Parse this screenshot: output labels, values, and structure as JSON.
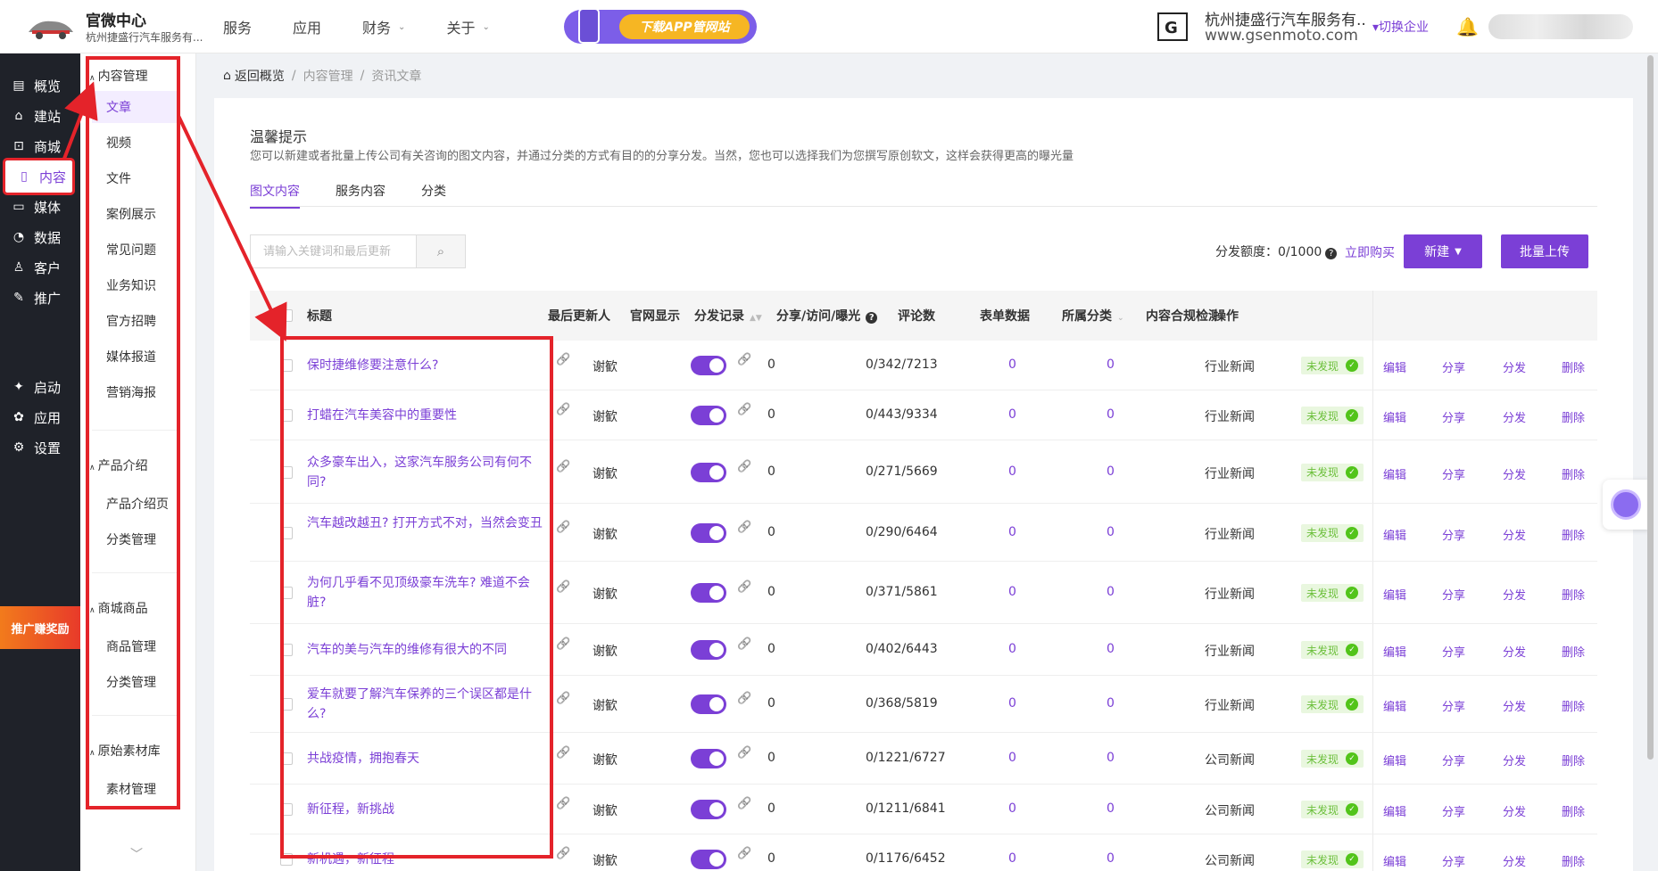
{
  "header": {
    "brand_name": "官微中心",
    "brand_sub": "杭州捷盛行汽车服务有...",
    "nav": [
      {
        "label": "服务",
        "has_caret": false
      },
      {
        "label": "应用",
        "has_caret": false
      },
      {
        "label": "财务",
        "has_caret": true
      },
      {
        "label": "关于",
        "has_caret": true
      }
    ],
    "app_banner_label": "下载APP管网站",
    "company_logo_letter": "G",
    "company_name": "杭州捷盛行汽车服务有...",
    "company_site": "www.gsenmoto.com",
    "switch_company": "▾切换企业"
  },
  "sidebar": {
    "items": [
      {
        "label": "概览",
        "icon": "overview-icon"
      },
      {
        "label": "建站",
        "icon": "home-icon"
      },
      {
        "label": "商城",
        "icon": "cart-icon"
      },
      {
        "label": "内容",
        "icon": "document-icon"
      },
      {
        "label": "媒体",
        "icon": "video-icon"
      },
      {
        "label": "数据",
        "icon": "chart-icon"
      },
      {
        "label": "客户",
        "icon": "user-icon"
      },
      {
        "label": "推广",
        "icon": "tag-icon"
      },
      {
        "label": "启动",
        "icon": "launch-icon"
      },
      {
        "label": "应用",
        "icon": "apps-icon"
      },
      {
        "label": "设置",
        "icon": "gear-icon"
      }
    ],
    "active": "内容",
    "promo": "推广赚奖励"
  },
  "submenu": {
    "groups": [
      {
        "title": "内容管理",
        "items": [
          "文章",
          "视频",
          "文件",
          "案例展示",
          "常见问题",
          "业务知识",
          "官方招聘",
          "媒体报道",
          "营销海报"
        ]
      },
      {
        "title": "产品介绍",
        "items": [
          "产品介绍页",
          "分类管理"
        ]
      },
      {
        "title": "商城商品",
        "items": [
          "商品管理",
          "分类管理"
        ]
      },
      {
        "title": "原始素材库",
        "items": [
          "素材管理"
        ]
      }
    ],
    "active": "文章"
  },
  "breadcrumb": {
    "home": "返回概览",
    "level1": "内容管理",
    "level2": "资讯文章"
  },
  "tip": {
    "title": "温馨提示",
    "text": "您可以新建或者批量上传公司有关咨询的图文内容，并通过分类的方式有目的的分享分发。当然，您也可以选择我们为您撰写原创软文，这样会获得更高的曝光量"
  },
  "tabs": [
    "图文内容",
    "服务内容",
    "分类"
  ],
  "toolbar": {
    "search_placeholder": "请输入关键词和最后更新",
    "quota_label": "分发额度：0/1000",
    "buy_link": "立即购买",
    "new_button": "新建",
    "upload_button": "批量上传"
  },
  "table": {
    "headers": {
      "title": "标题",
      "updater": "最后更新人",
      "site_display": "官网显示",
      "dist_record": "分发记录",
      "share_stats": "分享/访问/曝光",
      "comments": "评论数",
      "forms": "表单数据",
      "category": "所属分类",
      "compliance": "内容合规检测",
      "ops": "操作"
    },
    "rows": [
      {
        "title": "保时捷维修要注意什么?",
        "updater": "谢歓",
        "dist": "0",
        "stats": "0/342/7213",
        "comments": "0",
        "forms": "0",
        "category": "行业新闻",
        "status": "未发现"
      },
      {
        "title": "打蜡在汽车美容中的重要性",
        "updater": "谢歓",
        "dist": "0",
        "stats": "0/443/9334",
        "comments": "0",
        "forms": "0",
        "category": "行业新闻",
        "status": "未发现"
      },
      {
        "title": "众多豪车出入，这家汽车服务公司有何不同?",
        "updater": "谢歓",
        "dist": "0",
        "stats": "0/271/5669",
        "comments": "0",
        "forms": "0",
        "category": "行业新闻",
        "status": "未发现"
      },
      {
        "title": "汽车越改越丑? 打开方式不对，当然会变丑",
        "updater": "谢歓",
        "dist": "0",
        "stats": "0/290/6464",
        "comments": "0",
        "forms": "0",
        "category": "行业新闻",
        "status": "未发现"
      },
      {
        "title": "为何几乎看不见顶级豪车洗车? 难道不会脏?",
        "updater": "谢歓",
        "dist": "0",
        "stats": "0/371/5861",
        "comments": "0",
        "forms": "0",
        "category": "行业新闻",
        "status": "未发现"
      },
      {
        "title": "汽车的美与汽车的维修有很大的不同",
        "updater": "谢歓",
        "dist": "0",
        "stats": "0/402/6443",
        "comments": "0",
        "forms": "0",
        "category": "行业新闻",
        "status": "未发现"
      },
      {
        "title": "爱车就要了解汽车保养的三个误区都是什么?",
        "updater": "谢歓",
        "dist": "0",
        "stats": "0/368/5819",
        "comments": "0",
        "forms": "0",
        "category": "行业新闻",
        "status": "未发现"
      },
      {
        "title": "共战疫情，拥抱春天",
        "updater": "谢歓",
        "dist": "0",
        "stats": "0/1221/6727",
        "comments": "0",
        "forms": "0",
        "category": "公司新闻",
        "status": "未发现"
      },
      {
        "title": "新征程，新挑战",
        "updater": "谢歓",
        "dist": "0",
        "stats": "0/1211/6841",
        "comments": "0",
        "forms": "0",
        "category": "公司新闻",
        "status": "未发现"
      },
      {
        "title": "新机遇，新征程",
        "updater": "谢歓",
        "dist": "0",
        "stats": "0/1176/6452",
        "comments": "0",
        "forms": "0",
        "category": "公司新闻",
        "status": "未发现"
      }
    ],
    "actions": [
      "编辑",
      "分享",
      "分发",
      "删除"
    ]
  },
  "colors": {
    "accent": "#7b3fd6",
    "highlight": "#e4232a",
    "success": "#52c41a"
  }
}
